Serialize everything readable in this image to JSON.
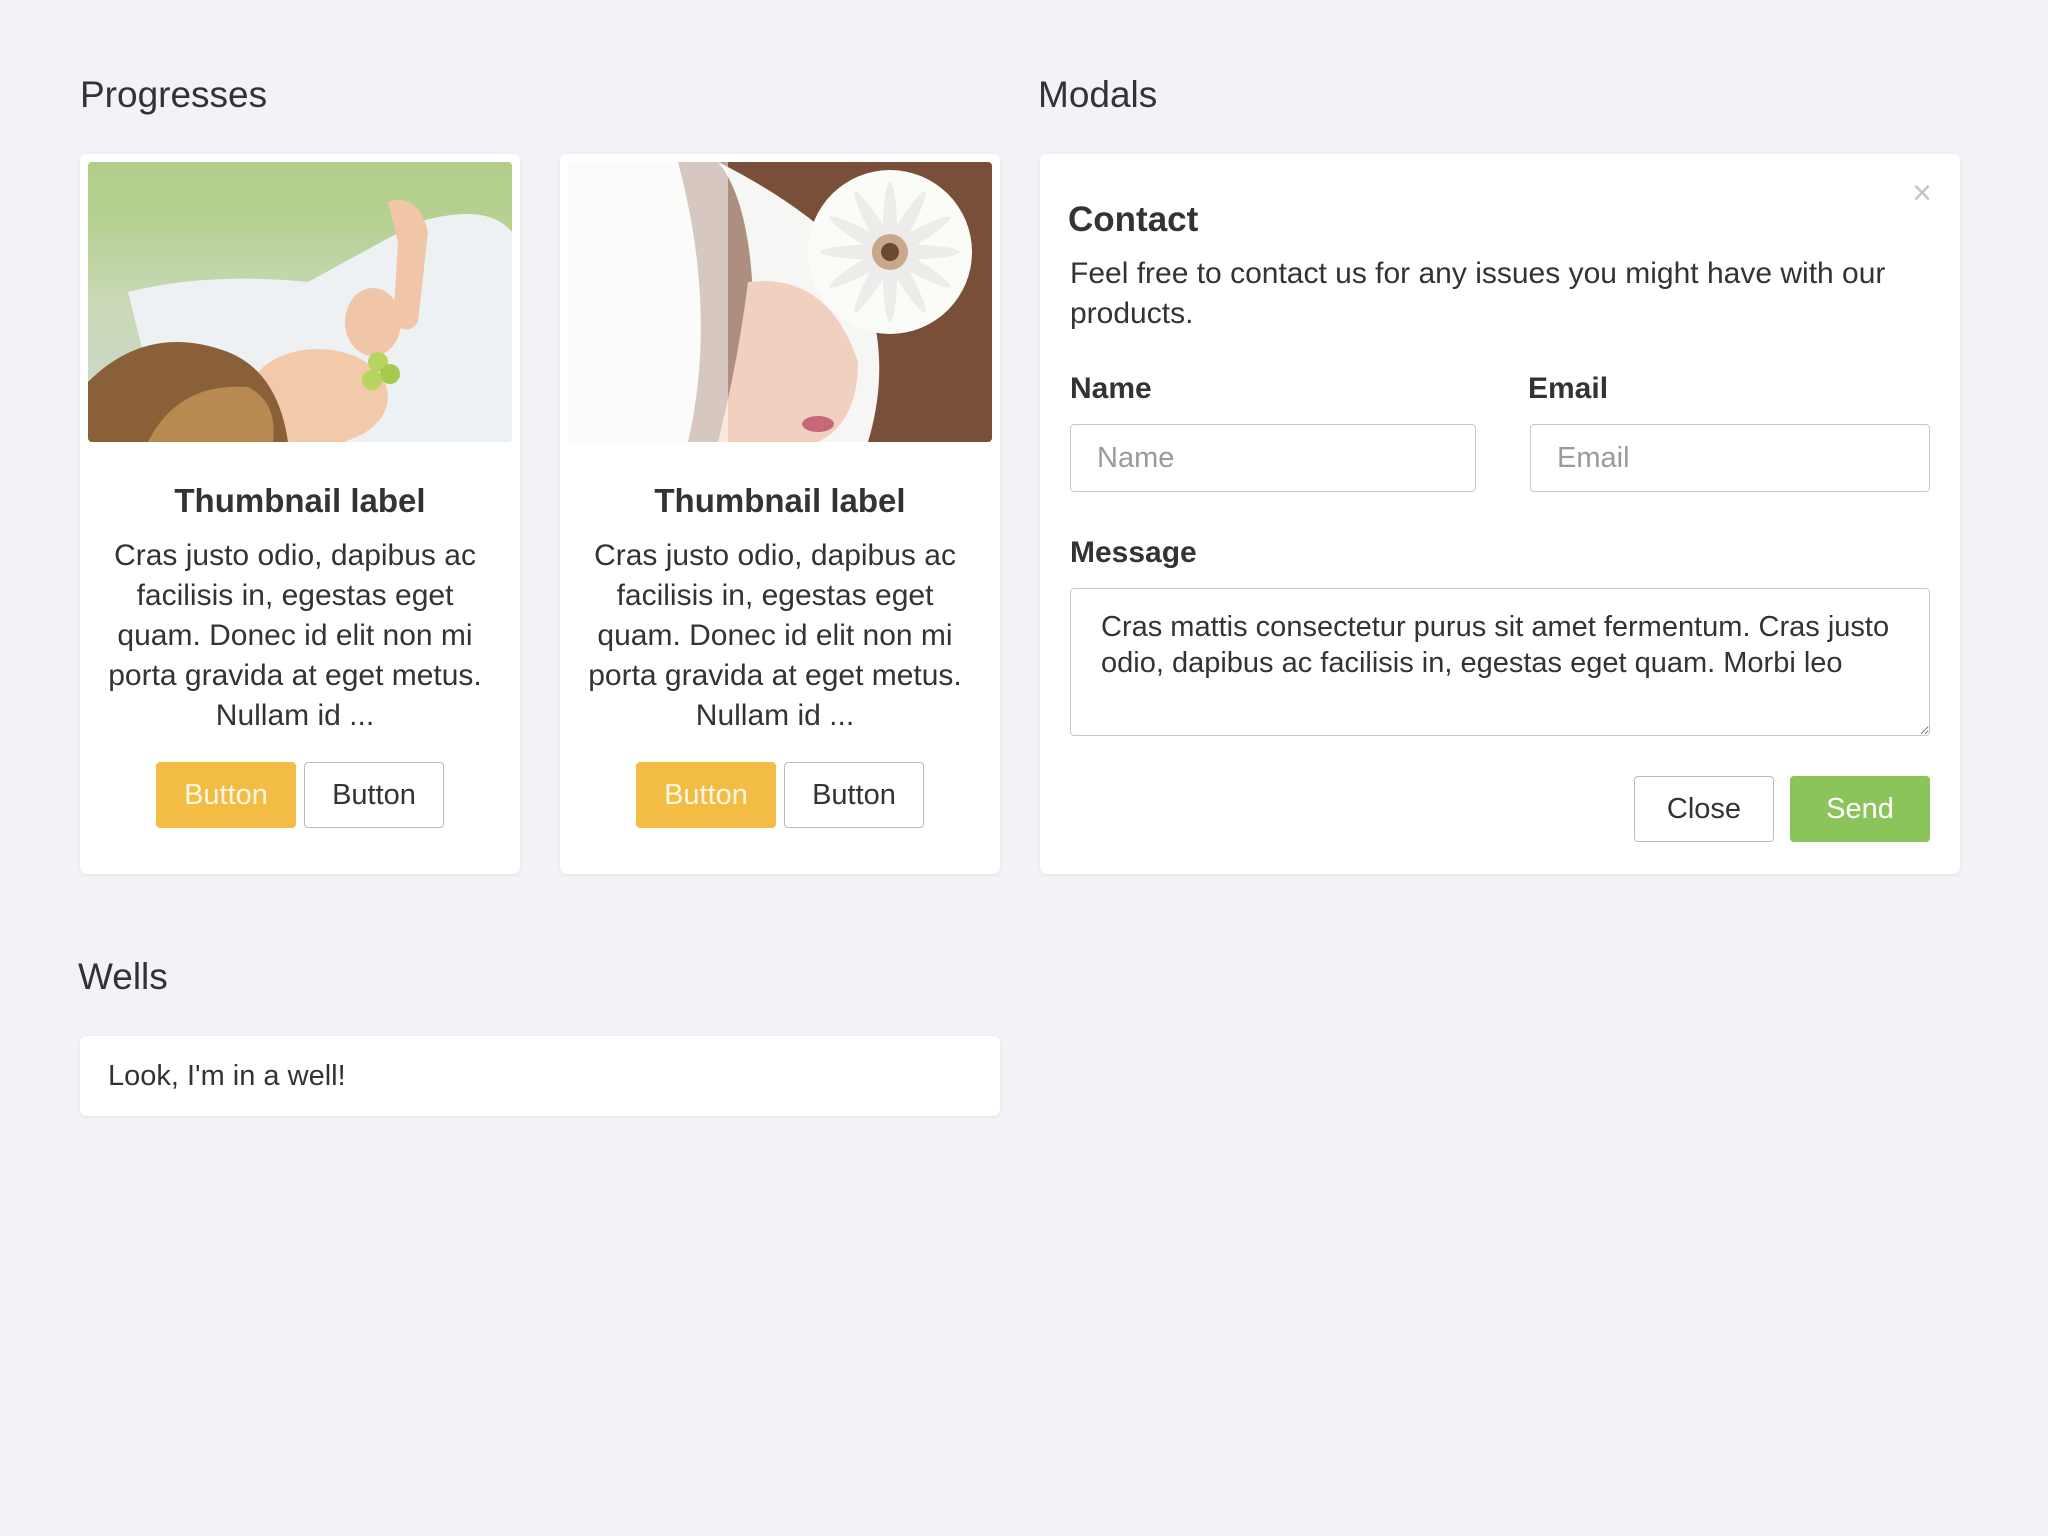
{
  "sections": {
    "progresses_title": "Progresses",
    "modals_title": "Modals",
    "wells_title": "Wells"
  },
  "thumbnails": [
    {
      "image": "woman-lying-in-grass",
      "label": "Thumbnail label",
      "text": "Cras justo odio, dapibus ac facilisis in, egestas eget quam. Donec id elit non mi porta gravida at eget metus. Nullam id ...",
      "primary_button": "Button",
      "secondary_button": "Button"
    },
    {
      "image": "woman-with-flower",
      "label": "Thumbnail label",
      "text": "Cras justo odio, dapibus ac facilisis in, egestas eget quam. Donec id elit non mi porta gravida at eget metus. Nullam id ...",
      "primary_button": "Button",
      "secondary_button": "Button"
    }
  ],
  "modal": {
    "close_symbol": "×",
    "title": "Contact",
    "description": "Feel free to contact us for any issues you might have with our products.",
    "name_label": "Name",
    "name_placeholder": "Name",
    "email_label": "Email",
    "email_placeholder": "Email",
    "message_label": "Message",
    "message_value": "Cras mattis consectetur purus sit amet fermentum. Cras justo odio, dapibus ac facilisis in, egestas eget quam. Morbi leo",
    "close_button": "Close",
    "send_button": "Send"
  },
  "well": {
    "text": "Look, I'm in a well!"
  },
  "colors": {
    "background": "#f2f2f7",
    "warning": "#f3bd45",
    "success": "#8bc45a",
    "card": "#ffffff"
  }
}
